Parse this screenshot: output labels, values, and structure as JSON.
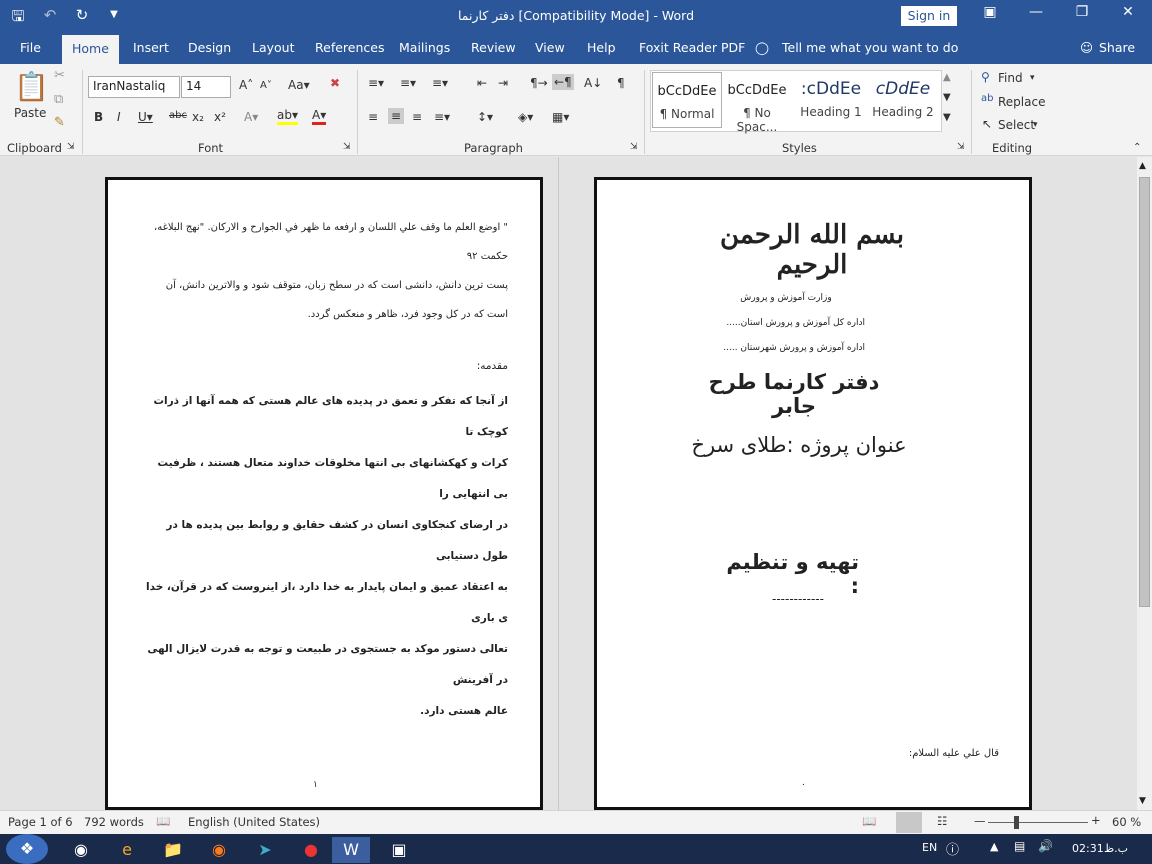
{
  "title_bar": {
    "title": "دفتر کارنما [Compatibility Mode]  -  Word",
    "sign_in": "Sign in"
  },
  "tabs": [
    "File",
    "Home",
    "Insert",
    "Design",
    "Layout",
    "References",
    "Mailings",
    "Review",
    "View",
    "Help",
    "Foxit Reader PDF"
  ],
  "tell_me": "Tell me what you want to do",
  "share": "Share",
  "ribbon": {
    "paste": "Paste",
    "font_name": "IranNastaliq",
    "font_size": "14",
    "styles": [
      {
        "preview": "bCcDdEe",
        "name": "¶ Normal"
      },
      {
        "preview": "bCcDdEe",
        "name": "¶ No Spac..."
      },
      {
        "preview": ":cDdEe",
        "name": "Heading 1"
      },
      {
        "preview": "cDdEe",
        "name": "Heading 2"
      }
    ],
    "find": "Find",
    "replace": "Replace",
    "select": "Select",
    "groups": {
      "clipboard": "Clipboard",
      "font": "Font",
      "paragraph": "Paragraph",
      "styles": "Styles",
      "editing": "Editing"
    }
  },
  "page_left": {
    "quote": "\" اوضع العلم ما وقف علي اللسان و ارفعه ما ظهر في الجوارح و الارکان. \"نهج البلاغه، حکمت ۹۲",
    "translation": "پست ترین دانش، دانشی است که در سطح زبان، متوقف شود و والاترین دانش، آن است که در کل وجود  فرد، ظاهر و منعکس گردد.",
    "intro_heading": "مقدمه:",
    "intro_lines": [
      "از آنجا که تفکر و تعمق در پدیده های عالم هستی که همه آنها از ذرات کوچک تا",
      "کرات و کهکشانهای بی انتها مخلوقات خداوند متعال هستند ، ظرفیت بی انتهایی را",
      "در ارضای کنجکاوی انسان در کشف حقایق و روابط بین پدیده ها در طول دستیابی",
      "به اعتقاد عمیق و ایمان پایدار به خدا دارد ،از اینروست که در قرآن، خدا ی باری",
      "تعالی دستور موکد به جستجوی در طبیعت و توجه به قدرت لایزال الهی در آفرینش",
      "عالم هستی دارد."
    ],
    "page_number": "۱"
  },
  "page_right": {
    "bismillah": "بسم الله الرحمن الرحیم",
    "ministry": "وزارت آموزش و پرورش",
    "province": "اداره کل آموزش و پرورش استان.....",
    "city": "اداره آموزش و پرورش شهرستان .....",
    "doc_title": "دفتر کارنما طرح جابر",
    "project_title": "عنوان پروژه :طلای سرخ",
    "prepared_by": "تهیه و تنظیم :",
    "dashes": "------------",
    "footer_quote": "قال علي عليه السلام:",
    "page_number": "۰"
  },
  "status": {
    "page": "Page 1 of 6",
    "words": "792 words",
    "language": "English (United States)",
    "zoom": "60 %"
  },
  "taskbar": {
    "lang": "EN",
    "time": "02:31",
    "ampm": "ب.ظ"
  }
}
